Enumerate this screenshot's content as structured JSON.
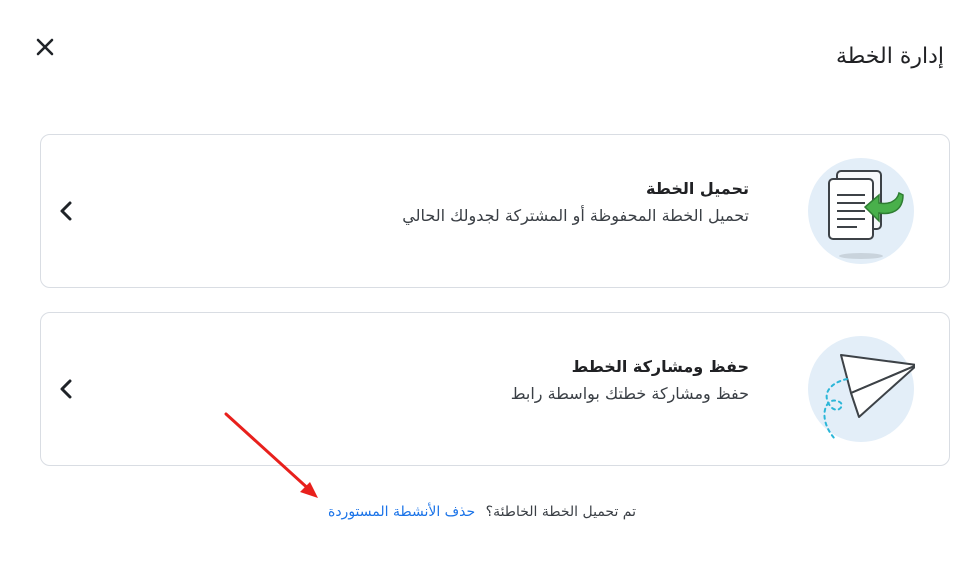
{
  "header": {
    "title": "إدارة الخطة",
    "close_icon": "close-icon"
  },
  "cards": [
    {
      "title": "تحميل الخطة",
      "description": "تحميل الخطة المحفوظة أو المشتركة لجدولك الحالي",
      "icon": "load-document-icon",
      "chevron": "chevron-left-icon"
    },
    {
      "title": "حفظ ومشاركة الخطط",
      "description": "حفظ ومشاركة خطتك بواسطة رابط",
      "icon": "paper-plane-icon",
      "chevron": "chevron-left-icon"
    }
  ],
  "footer": {
    "question": "تم تحميل الخطة الخاطئة؟",
    "link": "حذف الأنشطة المستوردة"
  },
  "colors": {
    "accent_link": "#1a73e8",
    "icon_bg": "#e3eef8",
    "green": "#49b04b",
    "annotation_arrow": "#e8201c"
  }
}
